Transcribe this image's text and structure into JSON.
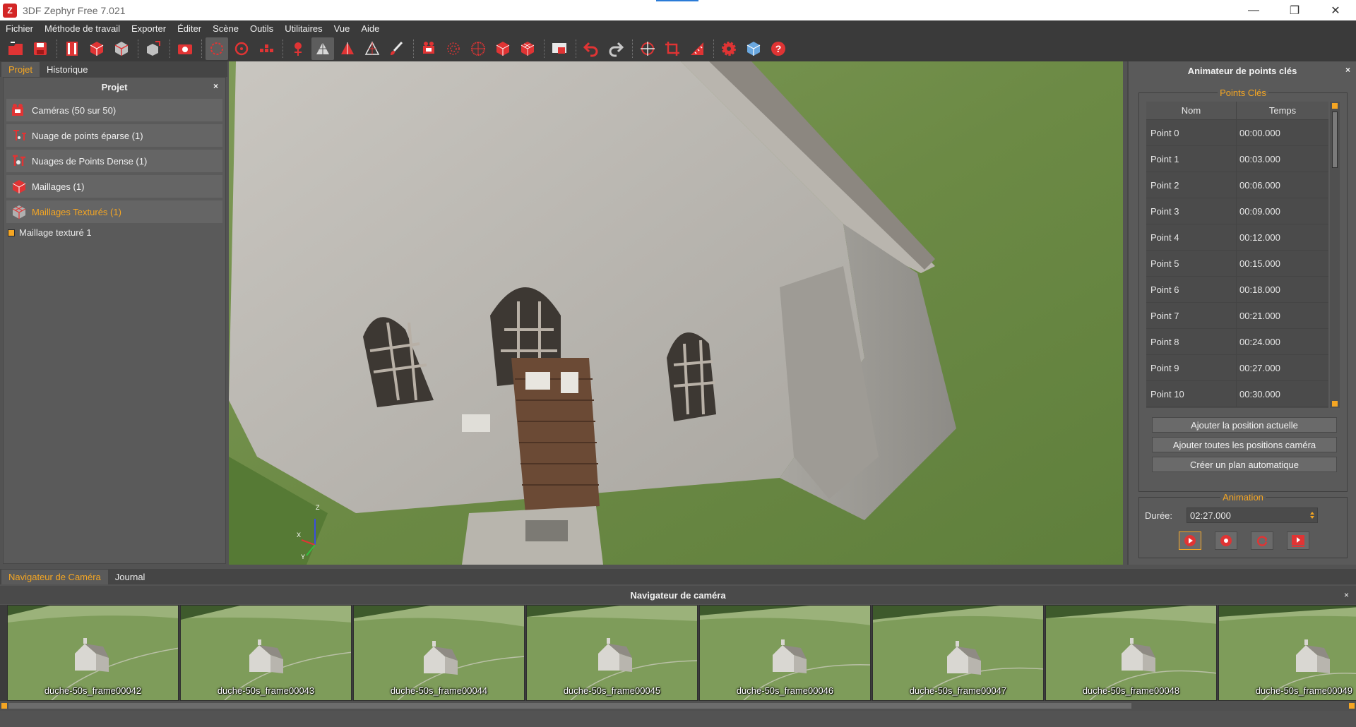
{
  "window": {
    "title": "3DF Zephyr Free 7.021",
    "controls": [
      "minimize-icon",
      "restore-icon",
      "close-icon"
    ]
  },
  "menu": [
    "Fichier",
    "Méthode de travail",
    "Exporter",
    "Éditer",
    "Scène",
    "Outils",
    "Utilitaires",
    "Vue",
    "Aide"
  ],
  "toolbar": {
    "icons": [
      "new-project-icon",
      "save-icon",
      "film-icon",
      "red-cube-icon",
      "cube-grid-icon",
      "export-cube-icon",
      "camera-icon",
      "select-circle-icon",
      "rotate-icon",
      "points-icon",
      "marker-icon",
      "mesh-white-icon",
      "mesh-red-icon",
      "mesh-outline-icon",
      "brush-icon",
      "cameras-icon",
      "sphere-grid-icon",
      "sphere-dense-icon",
      "cube-solid-icon",
      "cube-wire-icon",
      "screen-camera-icon",
      "undo-icon",
      "redo-icon",
      "orbit-icon",
      "crop-icon",
      "ruler-icon",
      "settings-icon",
      "view-cube-icon",
      "help-icon"
    ]
  },
  "left": {
    "tabs": [
      "Projet",
      "Historique"
    ],
    "active_tab": "Projet",
    "panel_title": "Projet",
    "close": "×",
    "items": [
      {
        "label": "Caméras (50 sur 50)",
        "icon": "cameras-icon"
      },
      {
        "label": "Nuage de points éparse (1)",
        "icon": "sparse-cloud-icon"
      },
      {
        "label": "Nuages de Points Dense (1)",
        "icon": "dense-cloud-icon"
      },
      {
        "label": "Maillages (1)",
        "icon": "mesh-icon"
      },
      {
        "label": "Maillages Texturés (1)",
        "icon": "textured-mesh-icon"
      }
    ],
    "subitem": "Maillage texturé 1"
  },
  "viewport": {
    "axes": {
      "z": "Z",
      "x": "X",
      "y": "Y"
    }
  },
  "right": {
    "title": "Animateur de points clés",
    "close": "×",
    "keypoints_group": "Points Clés",
    "columns": [
      "Nom",
      "Temps"
    ],
    "rows": [
      [
        "Point 0",
        "00:00.000"
      ],
      [
        "Point 1",
        "00:03.000"
      ],
      [
        "Point 2",
        "00:06.000"
      ],
      [
        "Point 3",
        "00:09.000"
      ],
      [
        "Point 4",
        "00:12.000"
      ],
      [
        "Point 5",
        "00:15.000"
      ],
      [
        "Point 6",
        "00:18.000"
      ],
      [
        "Point 7",
        "00:21.000"
      ],
      [
        "Point 8",
        "00:24.000"
      ],
      [
        "Point 9",
        "00:27.000"
      ],
      [
        "Point 10",
        "00:30.000"
      ]
    ],
    "buttons": [
      "Ajouter la position actuelle",
      "Ajouter toutes les positions caméra",
      "Créer un plan automatique"
    ],
    "animation_group": "Animation",
    "duration_label": "Durée:",
    "duration_value": "02:27.000",
    "anim_buttons": [
      "play-icon",
      "record-icon",
      "loop-icon",
      "render-video-icon"
    ]
  },
  "bottom": {
    "tabs": [
      "Navigateur de Caméra",
      "Journal"
    ],
    "active_tab": "Navigateur de Caméra",
    "title": "Navigateur de caméra",
    "close": "×",
    "thumbnails": [
      "duche-50s_frame00042",
      "duche-50s_frame00043",
      "duche-50s_frame00044",
      "duche-50s_frame00045",
      "duche-50s_frame00046",
      "duche-50s_frame00047",
      "duche-50s_frame00048",
      "duche-50s_frame00049"
    ]
  },
  "colors": {
    "accent": "#f5a623",
    "panel": "#5a5a5a",
    "toolbar": "#3a3a3a",
    "red_icon": "#e03434"
  }
}
